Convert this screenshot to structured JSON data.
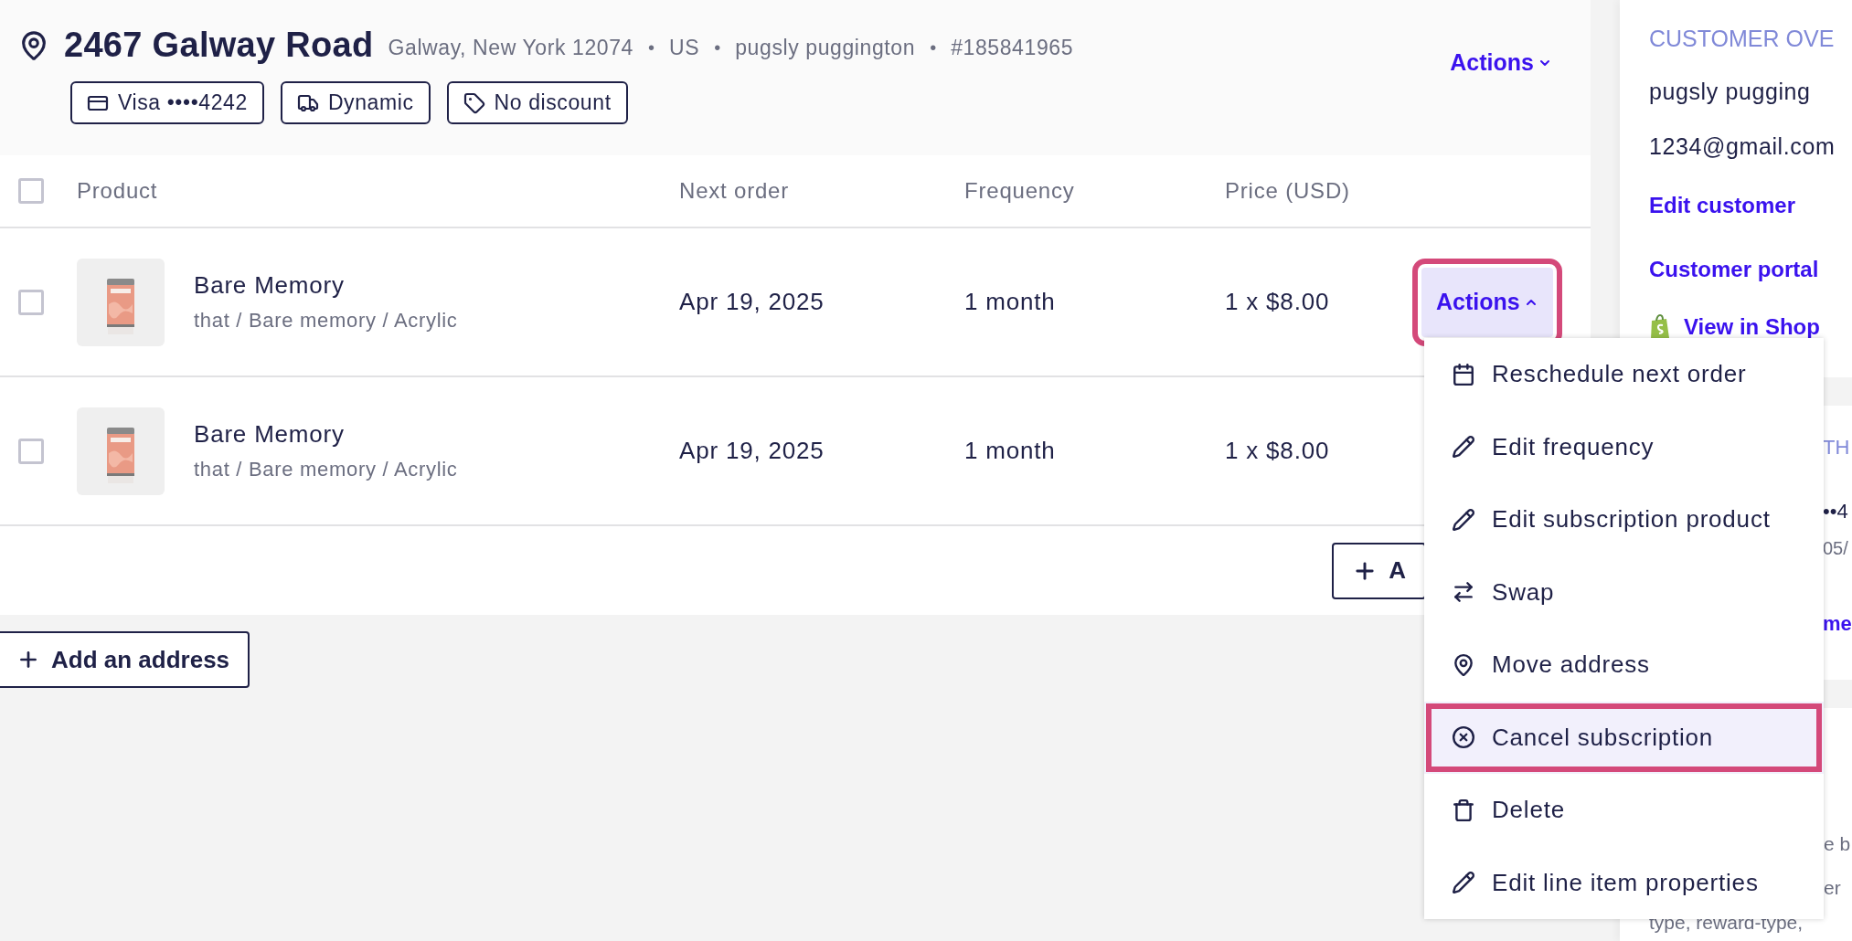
{
  "address": {
    "title": "2467 Galway Road",
    "separator": "•",
    "meta": [
      "Galway, New York 12074",
      "US",
      "pugsly puggington",
      "#185841965"
    ],
    "pills": [
      {
        "label": "Visa ••••4242"
      },
      {
        "label": "Dynamic"
      },
      {
        "label": "No discount"
      }
    ],
    "actions": {
      "label": "Actions"
    }
  },
  "table": {
    "header_checked": false,
    "columns": [
      "Product",
      "Next order",
      "Frequency",
      "Price (USD)"
    ],
    "rows": [
      {
        "checked": false,
        "name": "Bare Memory",
        "variant": "that / Bare memory / Acrylic",
        "next_order": "Apr 19, 2025",
        "frequency": "1 month",
        "price": "1 x $8.00",
        "actions": {
          "label": "Actions",
          "expanded": true
        }
      },
      {
        "checked": false,
        "name": "Bare Memory",
        "variant": "that / Bare memory / Acrylic",
        "next_order": "Apr 19, 2025",
        "frequency": "1 month",
        "price": "1 x $8.00"
      }
    ],
    "footer_button": {
      "label": "A"
    }
  },
  "add_address": {
    "label": "Add an address"
  },
  "menu": [
    {
      "label": "Reschedule next order",
      "selected": false
    },
    {
      "label": "Edit frequency",
      "selected": false
    },
    {
      "label": "Edit subscription product",
      "selected": false
    },
    {
      "label": "Swap",
      "selected": false
    },
    {
      "label": "Move address",
      "selected": false
    },
    {
      "label": "Cancel subscription",
      "selected": true
    },
    {
      "label": "Delete",
      "selected": false
    },
    {
      "label": "Edit line item properties",
      "selected": false
    }
  ],
  "sidebar": {
    "title": "CUSTOMER OVE",
    "name": "pugsly pugging",
    "email": "1234@gmail.com",
    "links": [
      "Edit customer",
      "Customer portal",
      "View in Shop"
    ],
    "fragments": [
      {
        "kind": "heading",
        "text": "TH"
      },
      {
        "kind": "value",
        "text": "••4"
      },
      {
        "kind": "muted",
        "text": "05/"
      },
      {
        "kind": "link",
        "text": "me"
      }
    ],
    "notes": [
      {
        "kind": "beside_menu",
        "text": "e b"
      },
      {
        "kind": "beside_menu",
        "text": "er"
      },
      {
        "kind": "full",
        "text": "type, reward-type,"
      }
    ]
  }
}
